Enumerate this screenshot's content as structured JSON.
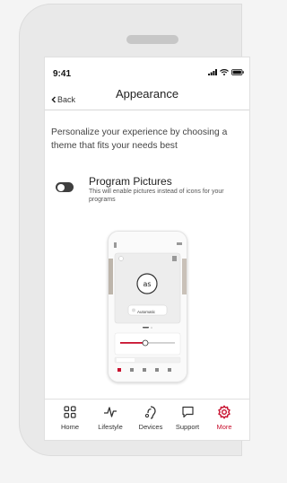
{
  "status_bar": {
    "time": "9:41"
  },
  "nav": {
    "back_label": "Back",
    "title": "Appearance"
  },
  "description": "Personalize your experience by choosing a theme that fits your needs best",
  "program_pictures": {
    "title": "Program Pictures",
    "subtitle": "This will enable pictures instead of icons for your programs",
    "enabled": false
  },
  "preview": {
    "program_label": "Automatic"
  },
  "tabs": [
    {
      "label": "Home",
      "icon": "grid-icon",
      "active": false
    },
    {
      "label": "Lifestyle",
      "icon": "activity-icon",
      "active": false
    },
    {
      "label": "Devices",
      "icon": "hearing-aid-icon",
      "active": false
    },
    {
      "label": "Support",
      "icon": "chat-icon",
      "active": false
    },
    {
      "label": "More",
      "icon": "gear-icon",
      "active": true
    }
  ],
  "colors": {
    "accent": "#c8102e",
    "toggle_off": "#3f3f3f"
  }
}
